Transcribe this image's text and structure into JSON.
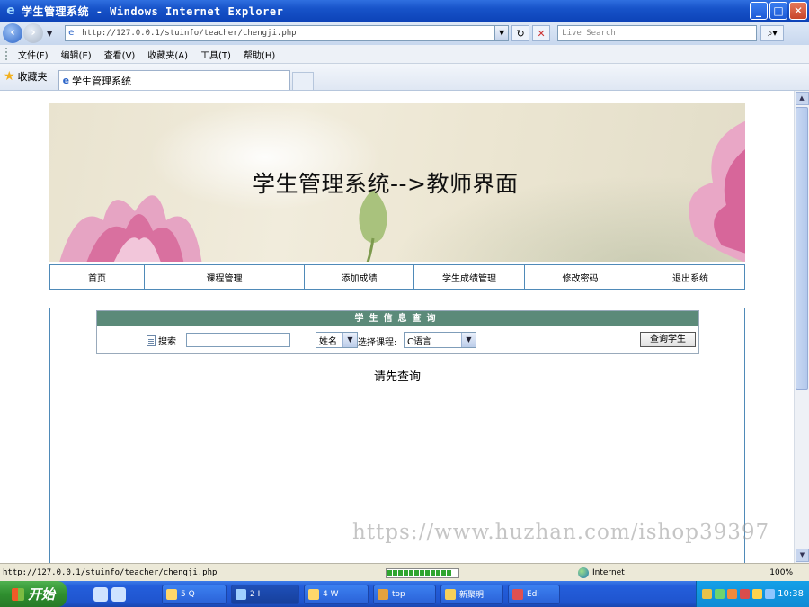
{
  "window": {
    "title": "学生管理系统 - Windows Internet Explorer",
    "minimize": "_",
    "maximize": "□",
    "close": "✕"
  },
  "address_bar": {
    "url": "http://127.0.0.1/stuinfo/teacher/chengji.php",
    "search_placeholder": "Live Search"
  },
  "menu": {
    "items": [
      "文件(F)",
      "编辑(E)",
      "查看(V)",
      "收藏夹(A)",
      "工具(T)",
      "帮助(H)"
    ]
  },
  "favorites_bar": {
    "favorites_label": "收藏夹",
    "tab_title": "学生管理系统"
  },
  "banner": {
    "title": "学生管理系统-->教师界面"
  },
  "nav": {
    "items": [
      "首页",
      "课程管理",
      "添加成绩",
      "学生成绩管理",
      "修改密码",
      "退出系统"
    ]
  },
  "query": {
    "header": "学生信息查询",
    "search_label": "搜索",
    "field_select": "姓名",
    "course_label": "选择课程:",
    "course_select": "C语言",
    "button": "查询学生",
    "result_message": "请先查询"
  },
  "watermark": "https://www.huzhan.com/ishop39397",
  "status_bar": {
    "url": "http://127.0.0.1/stuinfo/teacher/chengji.php",
    "zone": "Internet",
    "zoom": "100%"
  },
  "taskbar": {
    "start": "开始",
    "items": [
      "5 Q",
      "2 I",
      "4 W",
      "top",
      "新聚明",
      "Edi"
    ],
    "clock": "10:38"
  }
}
